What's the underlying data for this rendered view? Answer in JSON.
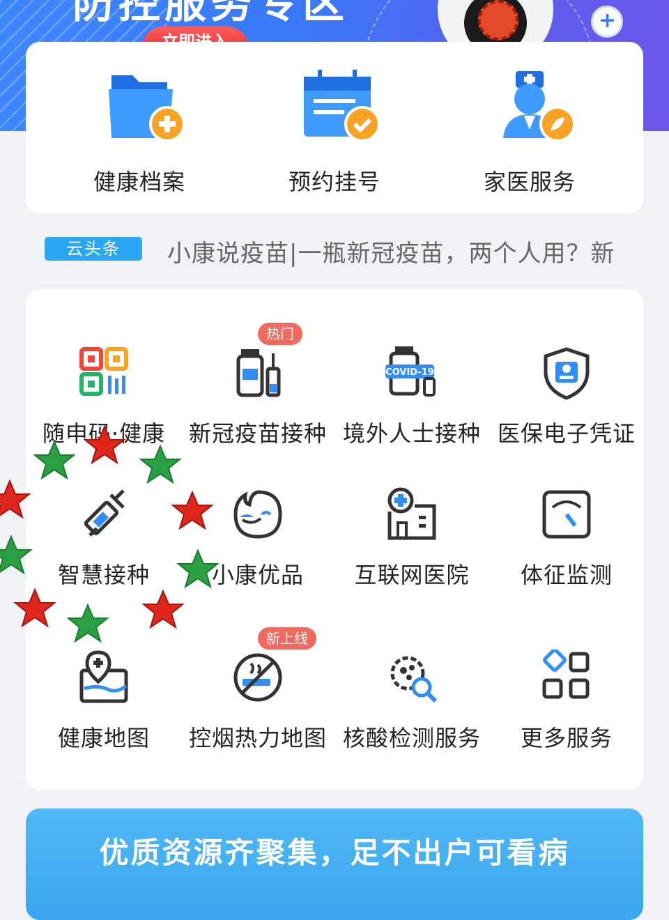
{
  "banner": {
    "title": "防控服务专区",
    "enter_button": "立即进入"
  },
  "top_services": [
    {
      "label": "健康档案",
      "icon": "folder-plus-icon"
    },
    {
      "label": "预约挂号",
      "icon": "calendar-check-icon"
    },
    {
      "label": "家医服务",
      "icon": "doctor-icon"
    }
  ],
  "news": {
    "tag": "云头条",
    "headline": "小康说疫苗|一瓶新冠疫苗，两个人用？新"
  },
  "services": [
    {
      "label": "随申码·健康",
      "icon": "qr-code-icon"
    },
    {
      "label": "新冠疫苗接种",
      "icon": "vaccine-bottle-icon",
      "badge": "热门"
    },
    {
      "label": "境外人士接种",
      "icon": "covid19-vaccine-icon"
    },
    {
      "label": "医保电子凭证",
      "icon": "shield-id-icon"
    },
    {
      "label": "智慧接种",
      "icon": "syringe-icon"
    },
    {
      "label": "小康优品",
      "icon": "mascot-face-icon"
    },
    {
      "label": "互联网医院",
      "icon": "hospital-icon"
    },
    {
      "label": "体征监测",
      "icon": "scale-gauge-icon"
    },
    {
      "label": "健康地图",
      "icon": "map-pin-icon"
    },
    {
      "label": "控烟热力地图",
      "icon": "no-smoking-icon",
      "badge": "新上线"
    },
    {
      "label": "核酸检测服务",
      "icon": "virus-search-icon"
    },
    {
      "label": "更多服务",
      "icon": "grid-more-icon"
    }
  ],
  "promo": {
    "title": "优质资源齐聚集，足不出户可看病"
  },
  "colors": {
    "primary_blue": "#3a78f5",
    "icon_blue": "#2f8df5",
    "badge_red": "#f06a5f",
    "news_tag_blue": "#2aa6f2",
    "orange_accent": "#f7a325"
  }
}
